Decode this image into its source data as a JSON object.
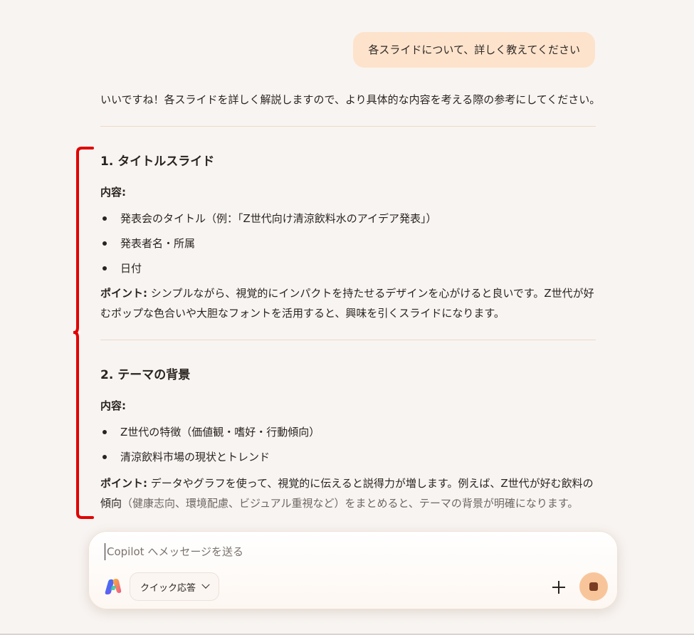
{
  "conversation": {
    "user_message": "各スライドについて、詳しく教えてください",
    "intro": "いいですね！各スライドを詳しく解説しますので、より具体的な内容を考える際の参考にしてください。",
    "sections": [
      {
        "heading": "1. タイトルスライド",
        "label": "内容:",
        "bullets": [
          "発表会のタイトル（例：「Z世代向け清涼飲料水のアイデア発表」）",
          "発表者名・所属",
          "日付"
        ],
        "point_label": "ポイント:",
        "point_text": "シンプルながら、視覚的にインパクトを持たせるデザインを心がけると良いです。Z世代が好むポップな色合いや大胆なフォントを活用すると、興味を引くスライドになります。"
      },
      {
        "heading": "2. テーマの背景",
        "label": "内容:",
        "bullets": [
          "Z世代の特徴（価値観・嗜好・行動傾向）",
          "清涼飲料市場の現状とトレンド"
        ],
        "point_label": "ポイント:",
        "point_text": "データやグラフを使って、視覚的に伝えると説得力が増します。例えば、Z世代が好む飲料の傾向",
        "point_text_faded": "（健康志向、環境配慮、ビジュアル重視など）をまとめると、テーマの背景が明確になります。"
      }
    ]
  },
  "composer": {
    "placeholder": "Copilot へメッセージを送る",
    "mode_label": "クイック応答",
    "icons": [
      "copilot-logo-icon",
      "chevron-down-icon",
      "plus-icon",
      "stop-icon"
    ]
  },
  "colors": {
    "background": "#f8f4f1",
    "user_bubble": "#fde3cc",
    "annotation_bracket": "#e00000",
    "stop_button": "#f8c59b"
  }
}
